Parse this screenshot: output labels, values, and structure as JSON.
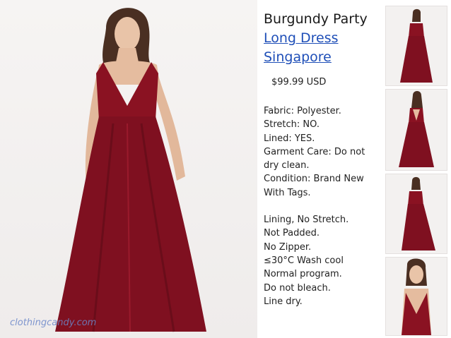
{
  "product": {
    "title_line1": "Burgundy Party",
    "title_link_line1": "Long Dress",
    "title_link_line2": "Singapore",
    "price": "$99.99 USD"
  },
  "details": {
    "fabric": "Fabric: Polyester.",
    "stretch": "Stretch: NO.",
    "lined": "Lined: YES.",
    "garment_care": "Garment Care: Do not dry clean.",
    "condition": "Condition: Brand New With Tags.",
    "lining": "Lining, No Stretch.",
    "padded": "Not Padded.",
    "zipper": "No Zipper.",
    "wash": "≤30°C Wash cool",
    "program": "Normal program.",
    "bleach": "Do not bleach.",
    "dry": "Line dry."
  },
  "watermark": "clothingcandy.com",
  "colors": {
    "dress": "#8a1222",
    "link": "#1f4fb8",
    "watermark": "#6a86c9"
  },
  "thumbnails": [
    "front-view",
    "back-view",
    "front-view-walking",
    "close-up-view"
  ]
}
